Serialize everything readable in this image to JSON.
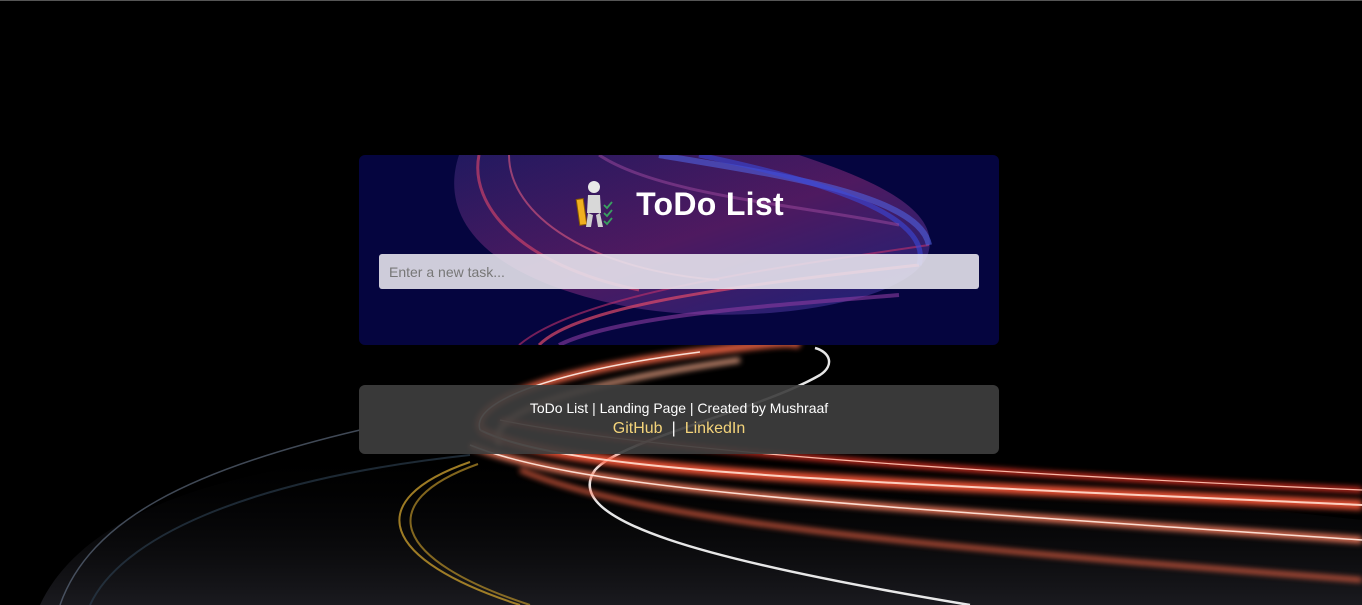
{
  "app": {
    "title": "ToDo List",
    "logo_icon": "person-checklist-icon"
  },
  "task_input": {
    "placeholder": "Enter a new task...",
    "value": ""
  },
  "footer": {
    "text": "ToDo List | Landing Page | Created by Mushraaf",
    "links": [
      {
        "label": "GitHub"
      },
      {
        "label": "LinkedIn"
      }
    ],
    "separator": "|",
    "link_color": "#f3d37a"
  },
  "colors": {
    "card_background": "#05053f",
    "page_background": "#000000"
  }
}
